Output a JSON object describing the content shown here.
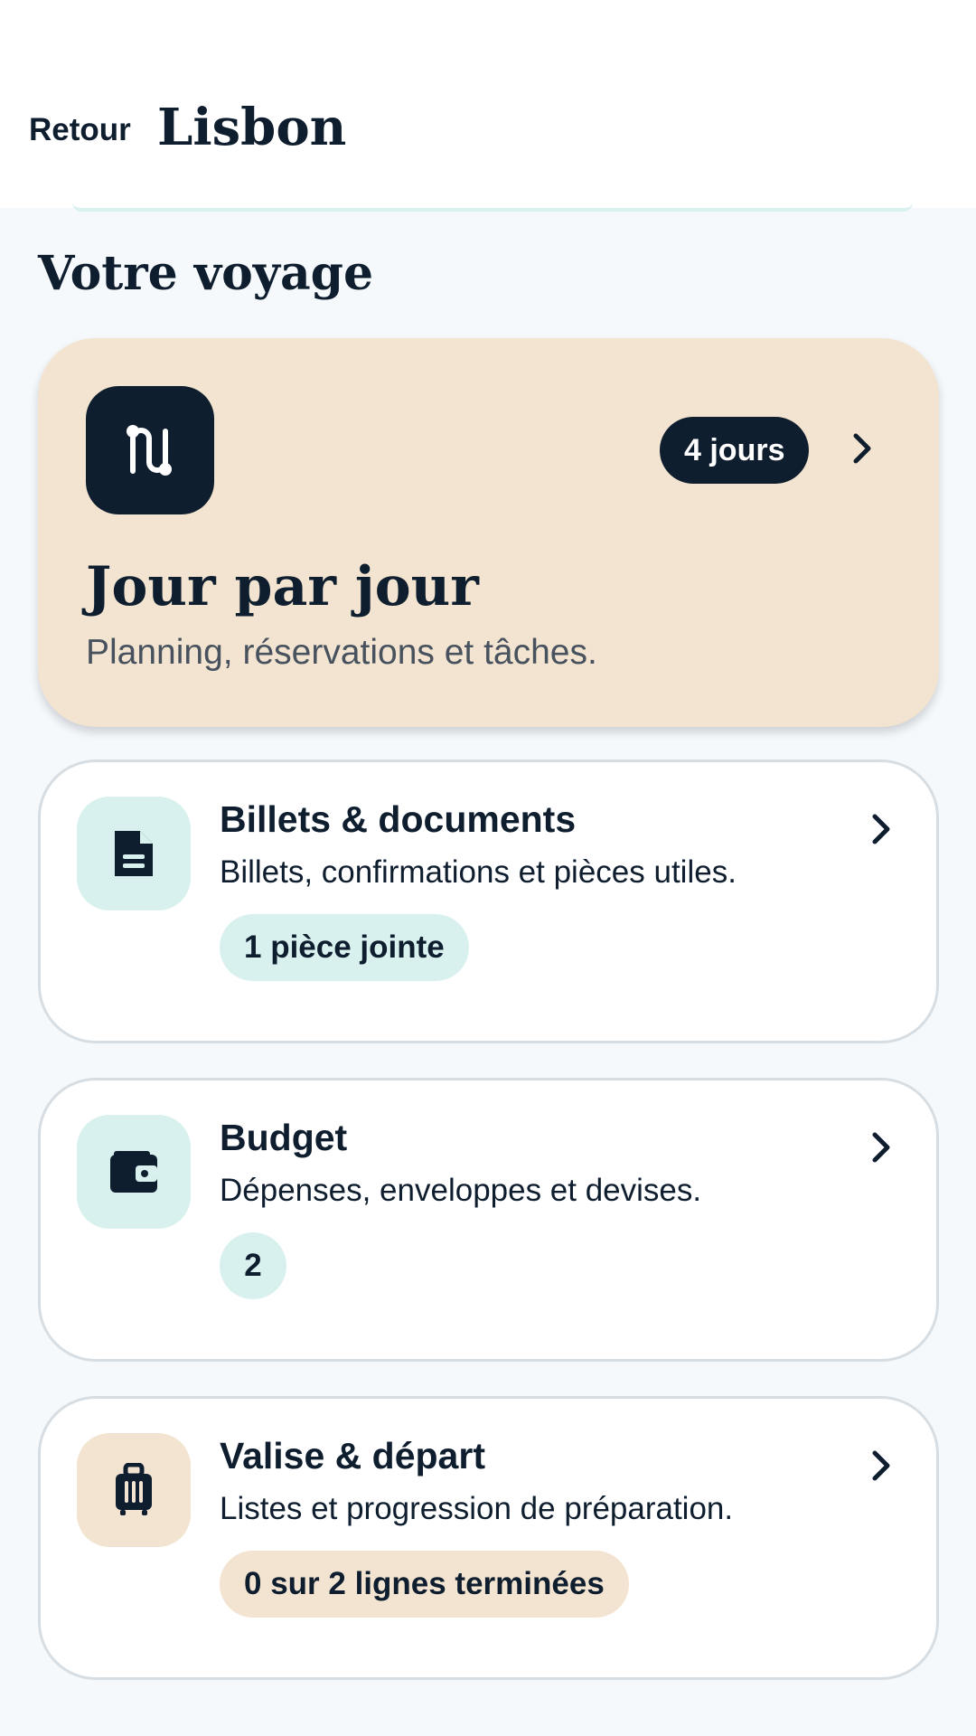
{
  "header": {
    "back_label": "Retour",
    "title": "Lisbon"
  },
  "section": {
    "title": "Votre voyage"
  },
  "hero": {
    "icon": "route-icon",
    "badge": "4 jours",
    "title": "Jour par jour",
    "subtitle": "Planning, réservations et tâches."
  },
  "cards": [
    {
      "icon": "document-icon",
      "title": "Billets & documents",
      "subtitle": "Billets, confirmations et pièces utiles.",
      "chip": "1 pièce jointe"
    },
    {
      "icon": "wallet-icon",
      "title": "Budget",
      "subtitle": "Dépenses, enveloppes et devises.",
      "chip": "2"
    },
    {
      "icon": "suitcase-icon",
      "title": "Valise & départ",
      "subtitle": "Listes et progression de préparation.",
      "chip": "0 sur 2 lignes terminées"
    }
  ],
  "colors": {
    "ink": "#0f1e2f",
    "sand": "#f2e4d0",
    "teal": "#d8f1ee",
    "background": "#f6f9fb"
  }
}
